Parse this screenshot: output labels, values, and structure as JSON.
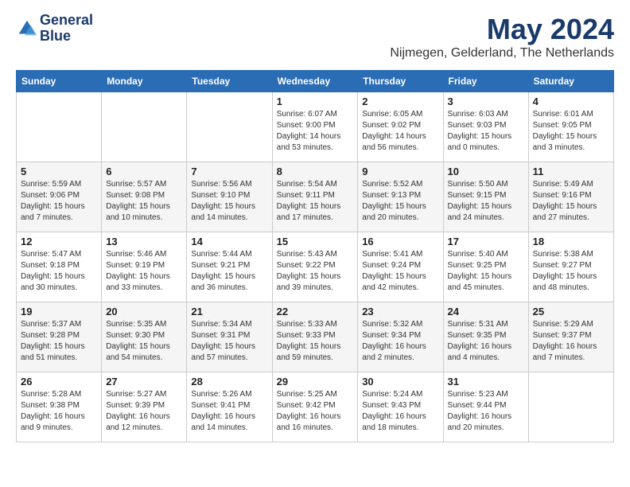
{
  "header": {
    "logo_line1": "General",
    "logo_line2": "Blue",
    "month_title": "May 2024",
    "location": "Nijmegen, Gelderland, The Netherlands"
  },
  "weekdays": [
    "Sunday",
    "Monday",
    "Tuesday",
    "Wednesday",
    "Thursday",
    "Friday",
    "Saturday"
  ],
  "weeks": [
    [
      {
        "day": "",
        "info": ""
      },
      {
        "day": "",
        "info": ""
      },
      {
        "day": "",
        "info": ""
      },
      {
        "day": "1",
        "info": "Sunrise: 6:07 AM\nSunset: 9:00 PM\nDaylight: 14 hours\nand 53 minutes."
      },
      {
        "day": "2",
        "info": "Sunrise: 6:05 AM\nSunset: 9:02 PM\nDaylight: 14 hours\nand 56 minutes."
      },
      {
        "day": "3",
        "info": "Sunrise: 6:03 AM\nSunset: 9:03 PM\nDaylight: 15 hours\nand 0 minutes."
      },
      {
        "day": "4",
        "info": "Sunrise: 6:01 AM\nSunset: 9:05 PM\nDaylight: 15 hours\nand 3 minutes."
      }
    ],
    [
      {
        "day": "5",
        "info": "Sunrise: 5:59 AM\nSunset: 9:06 PM\nDaylight: 15 hours\nand 7 minutes."
      },
      {
        "day": "6",
        "info": "Sunrise: 5:57 AM\nSunset: 9:08 PM\nDaylight: 15 hours\nand 10 minutes."
      },
      {
        "day": "7",
        "info": "Sunrise: 5:56 AM\nSunset: 9:10 PM\nDaylight: 15 hours\nand 14 minutes."
      },
      {
        "day": "8",
        "info": "Sunrise: 5:54 AM\nSunset: 9:11 PM\nDaylight: 15 hours\nand 17 minutes."
      },
      {
        "day": "9",
        "info": "Sunrise: 5:52 AM\nSunset: 9:13 PM\nDaylight: 15 hours\nand 20 minutes."
      },
      {
        "day": "10",
        "info": "Sunrise: 5:50 AM\nSunset: 9:15 PM\nDaylight: 15 hours\nand 24 minutes."
      },
      {
        "day": "11",
        "info": "Sunrise: 5:49 AM\nSunset: 9:16 PM\nDaylight: 15 hours\nand 27 minutes."
      }
    ],
    [
      {
        "day": "12",
        "info": "Sunrise: 5:47 AM\nSunset: 9:18 PM\nDaylight: 15 hours\nand 30 minutes."
      },
      {
        "day": "13",
        "info": "Sunrise: 5:46 AM\nSunset: 9:19 PM\nDaylight: 15 hours\nand 33 minutes."
      },
      {
        "day": "14",
        "info": "Sunrise: 5:44 AM\nSunset: 9:21 PM\nDaylight: 15 hours\nand 36 minutes."
      },
      {
        "day": "15",
        "info": "Sunrise: 5:43 AM\nSunset: 9:22 PM\nDaylight: 15 hours\nand 39 minutes."
      },
      {
        "day": "16",
        "info": "Sunrise: 5:41 AM\nSunset: 9:24 PM\nDaylight: 15 hours\nand 42 minutes."
      },
      {
        "day": "17",
        "info": "Sunrise: 5:40 AM\nSunset: 9:25 PM\nDaylight: 15 hours\nand 45 minutes."
      },
      {
        "day": "18",
        "info": "Sunrise: 5:38 AM\nSunset: 9:27 PM\nDaylight: 15 hours\nand 48 minutes."
      }
    ],
    [
      {
        "day": "19",
        "info": "Sunrise: 5:37 AM\nSunset: 9:28 PM\nDaylight: 15 hours\nand 51 minutes."
      },
      {
        "day": "20",
        "info": "Sunrise: 5:35 AM\nSunset: 9:30 PM\nDaylight: 15 hours\nand 54 minutes."
      },
      {
        "day": "21",
        "info": "Sunrise: 5:34 AM\nSunset: 9:31 PM\nDaylight: 15 hours\nand 57 minutes."
      },
      {
        "day": "22",
        "info": "Sunrise: 5:33 AM\nSunset: 9:33 PM\nDaylight: 15 hours\nand 59 minutes."
      },
      {
        "day": "23",
        "info": "Sunrise: 5:32 AM\nSunset: 9:34 PM\nDaylight: 16 hours\nand 2 minutes."
      },
      {
        "day": "24",
        "info": "Sunrise: 5:31 AM\nSunset: 9:35 PM\nDaylight: 16 hours\nand 4 minutes."
      },
      {
        "day": "25",
        "info": "Sunrise: 5:29 AM\nSunset: 9:37 PM\nDaylight: 16 hours\nand 7 minutes."
      }
    ],
    [
      {
        "day": "26",
        "info": "Sunrise: 5:28 AM\nSunset: 9:38 PM\nDaylight: 16 hours\nand 9 minutes."
      },
      {
        "day": "27",
        "info": "Sunrise: 5:27 AM\nSunset: 9:39 PM\nDaylight: 16 hours\nand 12 minutes."
      },
      {
        "day": "28",
        "info": "Sunrise: 5:26 AM\nSunset: 9:41 PM\nDaylight: 16 hours\nand 14 minutes."
      },
      {
        "day": "29",
        "info": "Sunrise: 5:25 AM\nSunset: 9:42 PM\nDaylight: 16 hours\nand 16 minutes."
      },
      {
        "day": "30",
        "info": "Sunrise: 5:24 AM\nSunset: 9:43 PM\nDaylight: 16 hours\nand 18 minutes."
      },
      {
        "day": "31",
        "info": "Sunrise: 5:23 AM\nSunset: 9:44 PM\nDaylight: 16 hours\nand 20 minutes."
      },
      {
        "day": "",
        "info": ""
      }
    ]
  ]
}
